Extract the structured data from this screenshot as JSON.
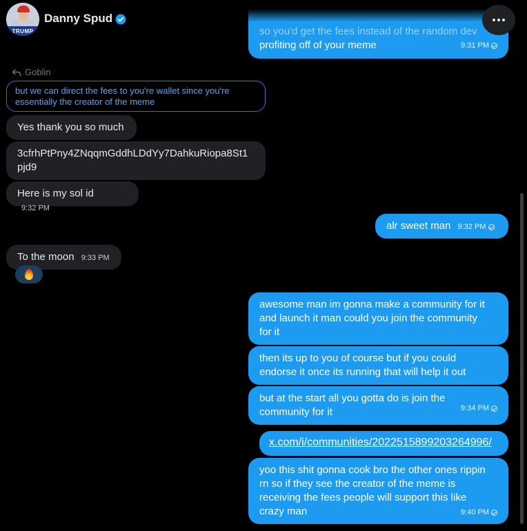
{
  "header": {
    "name": "Danny Spud",
    "avatar_sign": "TRUMP"
  },
  "messages": [
    {
      "id": "m1",
      "text_line1": "so you'd get the fees instead of the random dev",
      "text_line2": "profiting off of your meme",
      "time": "9:31 PM"
    },
    {
      "id": "m2",
      "reply_to": "Goblin",
      "quote": "but we can direct the fees to you're wallet since you're essentially the creator of the meme"
    },
    {
      "id": "m3",
      "text": "Yes thank you so much"
    },
    {
      "id": "m4",
      "text": "3cfrhPtPny4ZNqqmGddhLDdYy7DahkuRiopa8St1\npjd9"
    },
    {
      "id": "m5",
      "text": "Here is my sol id",
      "time": "9:32 PM"
    },
    {
      "id": "m6",
      "text": "alr sweet man",
      "time": "9:32 PM"
    },
    {
      "id": "m7",
      "text": "To the moon",
      "time": "9:33 PM"
    },
    {
      "id": "m8",
      "text": "awesome man im gonna make a community for it\nand launch it man could you join the community\nfor it"
    },
    {
      "id": "m9",
      "text": "then its up to you of course but if you could\nendorse it once its running that will help it out"
    },
    {
      "id": "m10",
      "text": "but at the start all you gotta do is join the\ncommunity for it",
      "time": "9:34 PM"
    },
    {
      "id": "m11",
      "link": "x.com/i/communities/2022515899203264996/"
    },
    {
      "id": "m12",
      "text": "yoo this shit gonna cook bro the other ones rippin\nrn so if they see the creator of the meme is\nreceiving the fees people will support this like\ncrazy man",
      "time": "9:40 PM"
    }
  ],
  "colors": {
    "outgoing": "#1d9bf0",
    "incoming": "#1f2124",
    "verified": "#1d9bf0"
  },
  "icons": {
    "more": "more-horizontal-icon",
    "verified": "verified-badge-icon",
    "reply": "reply-arrow-icon",
    "reaction": "fire-emoji-icon"
  }
}
